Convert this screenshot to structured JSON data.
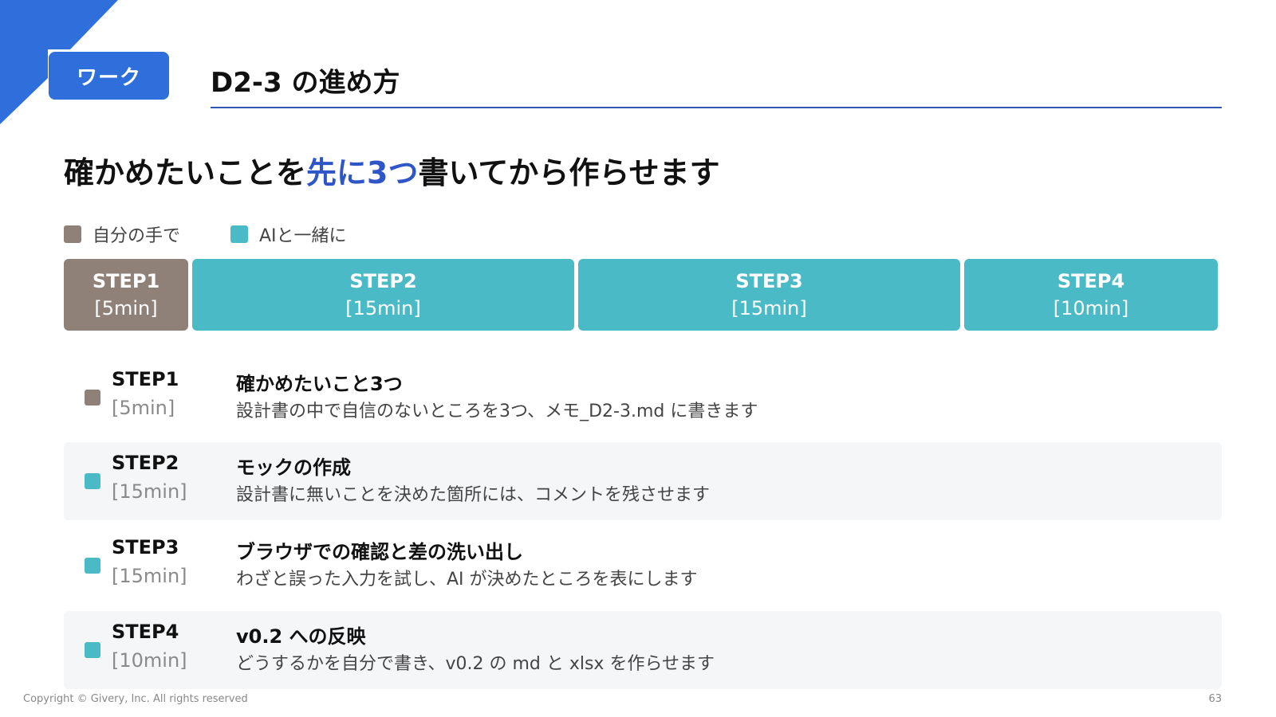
{
  "badge": "ワーク",
  "title": "D2-3 の進め方",
  "headline": {
    "pre": "確かめたいことを",
    "highlight": "先に3つ",
    "post": "書いてから作らせます"
  },
  "legend": [
    {
      "label": "自分の手で",
      "color": "#8f8178"
    },
    {
      "label": "AIと一緒に",
      "color": "#4bbac7"
    }
  ],
  "timeline": [
    {
      "step": "STEP1",
      "duration": "[5min]",
      "color": "#8f8178"
    },
    {
      "step": "STEP2",
      "duration": "[15min]",
      "color": "#4bbac7"
    },
    {
      "step": "STEP3",
      "duration": "[15min]",
      "color": "#4bbac7"
    },
    {
      "step": "STEP4",
      "duration": "[10min]",
      "color": "#4bbac7"
    }
  ],
  "steps": [
    {
      "step": "STEP1",
      "duration": "[5min]",
      "heading": "確かめたいこと3つ",
      "desc": "設計書の中で自信のないところを3つ、メモ_D2-3.md に書きます",
      "color": "#8f8178"
    },
    {
      "step": "STEP2",
      "duration": "[15min]",
      "heading": "モックの作成",
      "desc": "設計書に無いことを決めた箇所には、コメントを残させます",
      "color": "#4bbac7"
    },
    {
      "step": "STEP3",
      "duration": "[15min]",
      "heading": "ブラウザでの確認と差の洗い出し",
      "desc": "わざと誤った入力を試し、AI が決めたところを表にします",
      "color": "#4bbac7"
    },
    {
      "step": "STEP4",
      "duration": "[10min]",
      "heading": "v0.2 への反映",
      "desc": "どうするかを自分で書き、v0.2 の md と xlsx を作らせます",
      "color": "#4bbac7"
    }
  ],
  "footer": "Copyright © Givery, Inc. All rights reserved",
  "page_number": "63",
  "accent": "#2f6fdb"
}
